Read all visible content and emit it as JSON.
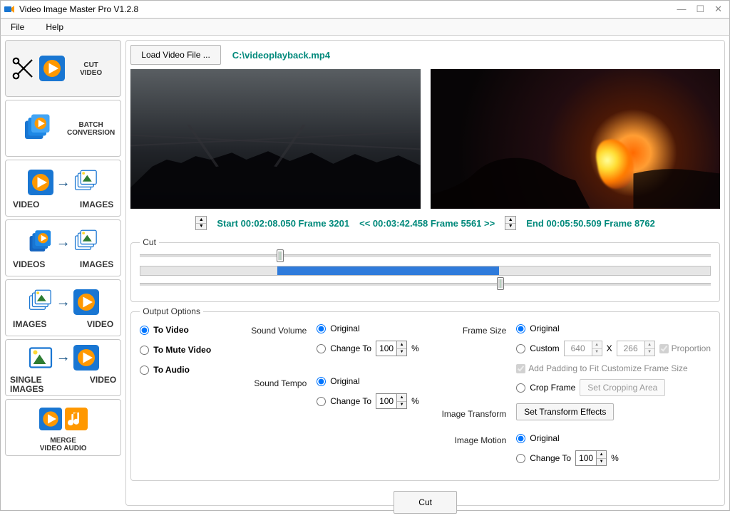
{
  "window": {
    "title": "Video Image Master Pro V1.2.8"
  },
  "menu": {
    "file": "File",
    "help": "Help"
  },
  "sidebar": {
    "cut_video": "CUT\nVIDEO",
    "batch": "BATCH\nCONVERSION",
    "v2i_left": "VIDEO",
    "v2i_right": "IMAGES",
    "vs2i_left": "VIDEOS",
    "vs2i_right": "IMAGES",
    "i2v_left": "IMAGES",
    "i2v_right": "VIDEO",
    "si2v_left": "SINGLE\nIMAGES",
    "si2v_right": "VIDEO",
    "merge": "MERGE\nVIDEO AUDIO"
  },
  "buttons": {
    "load": "Load Video File ...",
    "cut": "Cut",
    "set_crop": "Set Cropping Area",
    "set_transform": "Set Transform Effects"
  },
  "file_path": "C:\\videoplayback.mp4",
  "timeline": {
    "start": "Start 00:02:08.050  Frame 3201",
    "mid": "<< 00:03:42.458  Frame 5561 >>",
    "end": "End 00:05:50.509 Frame 8762"
  },
  "groups": {
    "cut": "Cut",
    "output": "Output Options"
  },
  "output": {
    "to_video": "To Video",
    "to_mute": "To Mute Video",
    "to_audio": "To Audio",
    "sound_volume": "Sound Volume",
    "sound_tempo": "Sound Tempo",
    "original": "Original",
    "change_to": "Change To",
    "sv_value": "100",
    "st_value": "100",
    "pct": "%",
    "frame_size": "Frame Size",
    "custom": "Custom",
    "w": "640",
    "x": "X",
    "h": "266",
    "proportion": "Proportion",
    "padding": "Add Padding to Fit Customize Frame Size",
    "crop_frame": "Crop Frame",
    "image_transform": "Image Transform",
    "image_motion": "Image Motion",
    "im_value": "100"
  }
}
